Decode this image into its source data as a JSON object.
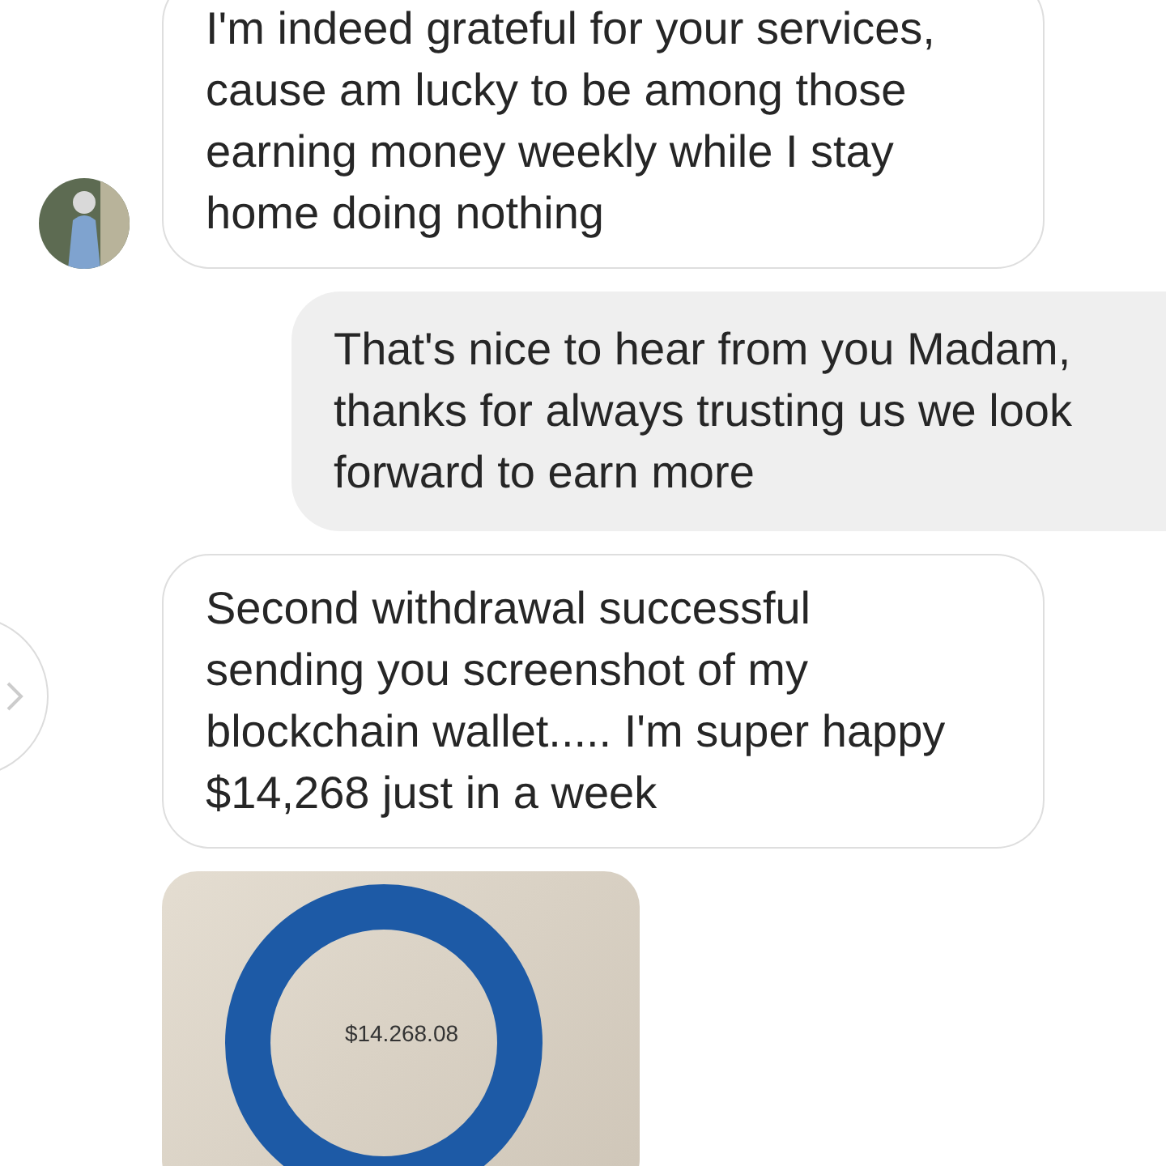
{
  "messages": [
    {
      "kind": "text",
      "outgoing": false,
      "avatar": true,
      "share_button": false,
      "text": "I'm indeed grateful for your services, cause am lucky to be among those earning money weekly while I stay home doing nothing"
    },
    {
      "kind": "text",
      "outgoing": true,
      "avatar": false,
      "share_button": false,
      "text": "That's nice to hear from you Madam, thanks for always trusting us we look forward to earn more"
    },
    {
      "kind": "text",
      "outgoing": false,
      "avatar": false,
      "share_button": true,
      "text": "Second withdrawal successful sending you screenshot of my blockchain wallet..... I'm super happy $14,268 just in a week"
    },
    {
      "kind": "image",
      "outgoing": false,
      "avatar": false,
      "share_button": false,
      "balance": "$14.268.08"
    }
  ]
}
